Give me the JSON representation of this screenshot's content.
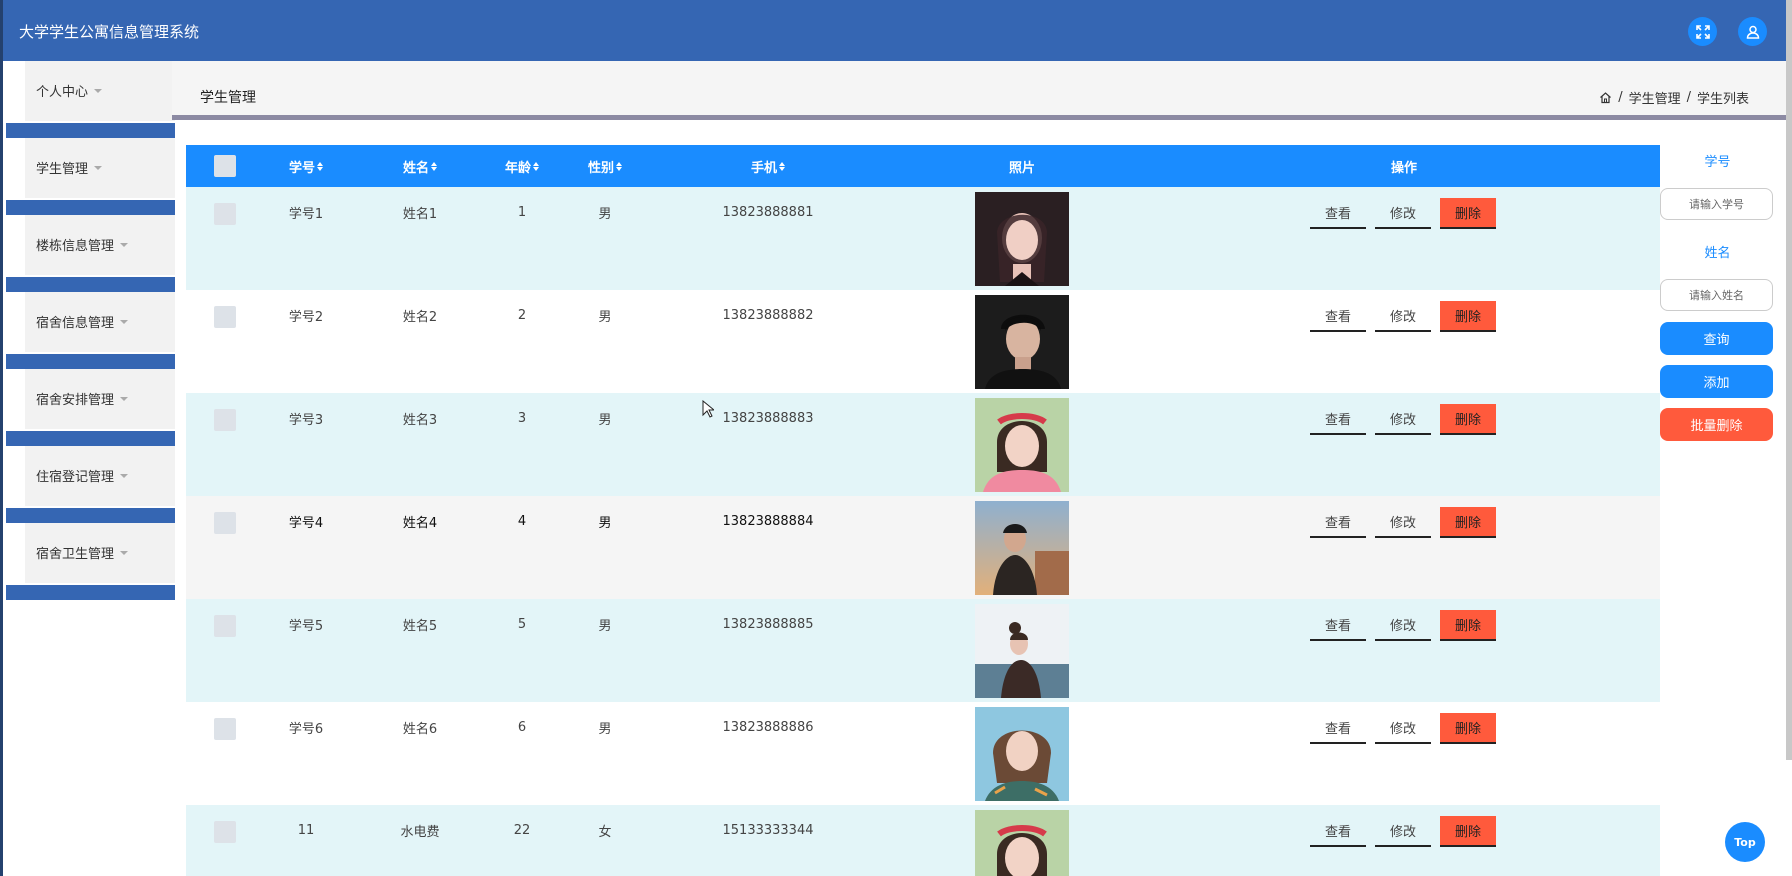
{
  "app": {
    "title": "大学学生公寓信息管理系统"
  },
  "topbar": {
    "fullscreen_icon": "fullscreen-icon",
    "user_icon": "user-icon"
  },
  "sidebar": {
    "items": [
      {
        "label": "个人中心"
      },
      {
        "label": "学生管理"
      },
      {
        "label": "楼栋信息管理"
      },
      {
        "label": "宿舍信息管理"
      },
      {
        "label": "宿舍安排管理"
      },
      {
        "label": "住宿登记管理"
      },
      {
        "label": "宿舍卫生管理"
      }
    ]
  },
  "header": {
    "page_title": "学生管理",
    "breadcrumb": {
      "home_icon": "home-icon",
      "level1": "学生管理",
      "separator": "/",
      "level2": "学生列表"
    }
  },
  "table": {
    "columns": [
      "学号",
      "姓名",
      "年龄",
      "性别",
      "手机",
      "照片",
      "操作"
    ],
    "rows": [
      {
        "id": "学号1",
        "name": "姓名1",
        "age": "1",
        "gender": "男",
        "phone": "13823888881"
      },
      {
        "id": "学号2",
        "name": "姓名2",
        "age": "2",
        "gender": "男",
        "phone": "13823888882"
      },
      {
        "id": "学号3",
        "name": "姓名3",
        "age": "3",
        "gender": "男",
        "phone": "13823888883"
      },
      {
        "id": "学号4",
        "name": "姓名4",
        "age": "4",
        "gender": "男",
        "phone": "13823888884"
      },
      {
        "id": "学号5",
        "name": "姓名5",
        "age": "5",
        "gender": "男",
        "phone": "13823888885"
      },
      {
        "id": "学号6",
        "name": "姓名6",
        "age": "6",
        "gender": "男",
        "phone": "13823888886"
      },
      {
        "id": "11",
        "name": "水电费",
        "age": "22",
        "gender": "女",
        "phone": "15133333344"
      }
    ],
    "actions": {
      "view": "查看",
      "edit": "修改",
      "delete": "删除"
    }
  },
  "search": {
    "id_label": "学号",
    "id_placeholder": "请输入学号",
    "name_label": "姓名",
    "name_placeholder": "请输入姓名",
    "query_button": "查询",
    "add_button": "添加",
    "batch_delete_button": "批量删除"
  },
  "top_button": {
    "label": "Top"
  },
  "colors": {
    "header": "#3566b3",
    "accent": "#1a8cff",
    "danger": "#ff5a3c",
    "row_alt": "#e3f5f8"
  }
}
